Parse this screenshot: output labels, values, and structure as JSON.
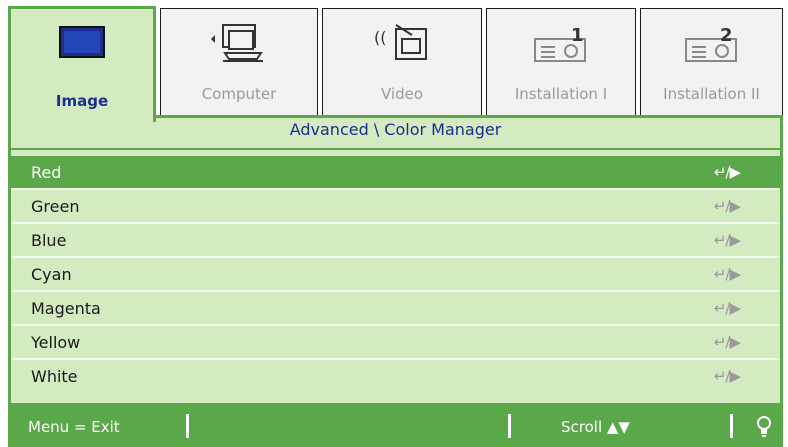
{
  "tabs": [
    {
      "label": "Image",
      "icon": "image-icon",
      "active": true
    },
    {
      "label": "Computer",
      "icon": "computer-icon",
      "active": false
    },
    {
      "label": "Video",
      "icon": "video-icon",
      "active": false
    },
    {
      "label": "Installation I",
      "icon": "installation-1-icon",
      "active": false
    },
    {
      "label": "Installation II",
      "icon": "installation-2-icon",
      "active": false
    }
  ],
  "breadcrumb": "Advanced \\ Color Manager",
  "items": [
    {
      "label": "Red",
      "action": "↵/▶",
      "selected": true
    },
    {
      "label": "Green",
      "action": "↵/▶",
      "selected": false
    },
    {
      "label": "Blue",
      "action": "↵/▶",
      "selected": false
    },
    {
      "label": "Cyan",
      "action": "↵/▶",
      "selected": false
    },
    {
      "label": "Magenta",
      "action": "↵/▶",
      "selected": false
    },
    {
      "label": "Yellow",
      "action": "↵/▶",
      "selected": false
    },
    {
      "label": "White",
      "action": "↵/▶",
      "selected": false
    }
  ],
  "status": {
    "menu_hint": "Menu = Exit",
    "scroll_hint": "Scroll ▲▼",
    "icon": "bulb-icon"
  },
  "colors": {
    "accent_green": "#5aa84a",
    "panel_green": "#d4eac0",
    "label_blue": "#1b2f8c"
  }
}
